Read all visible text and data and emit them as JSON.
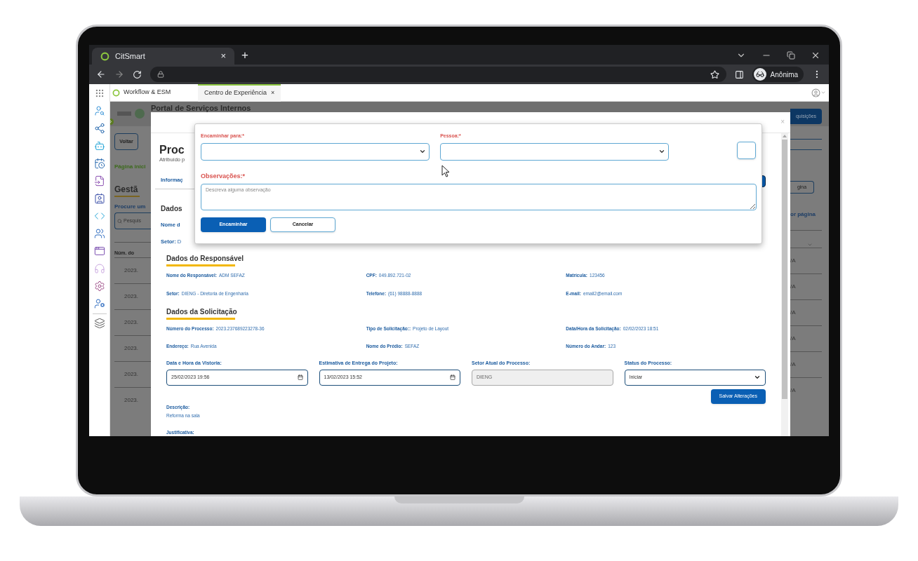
{
  "browser": {
    "tab": {
      "title": "CitSmart",
      "close": "×"
    },
    "new_tab": "+",
    "profile": "Anônima"
  },
  "app": {
    "product": "Workflow & ESM",
    "tab": {
      "title": "Centro de Experiência",
      "close": "×"
    }
  },
  "background_page": {
    "header": "Portal de Serviços Internos",
    "top_button": "quisições",
    "back_button": "Voltar",
    "breadcrumb": "Página inici",
    "heading": "Gestã",
    "search_label": "Procure um",
    "search_placeholder": "Pesquis",
    "column_1": "Núm. do",
    "right_button": "gina",
    "per_page": "or página",
    "rows": [
      {
        "column_1": "2023.",
        "column_2": "/A"
      },
      {
        "column_1": "2023.",
        "column_2": "/A"
      },
      {
        "column_1": "2023.",
        "column_2": "/A"
      },
      {
        "column_1": "2023.",
        "column_2": "/A"
      },
      {
        "column_1": "2023.",
        "column_2": "/A"
      },
      {
        "column_1": "2023.",
        "column_2": "/A"
      }
    ]
  },
  "process_modal": {
    "close": "×",
    "title": "Proc",
    "subtitle": "Atribuído p",
    "tab": "Informaç",
    "section_heading": "Dados",
    "field_1": "Nome d",
    "field_2": {
      "label": "Setor:",
      "value": "D"
    },
    "sections": [
      {
        "title": "Dados do Responsável",
        "fields": [
          {
            "label": "Nome do Responsável:",
            "value": "ADM SEFAZ"
          },
          {
            "label": "CPF:",
            "value": "049.892.721-02"
          },
          {
            "label": "Matrícula:",
            "value": "123456"
          },
          {
            "label": "Setor:",
            "value": "DIENG - Diretoria de Engenharia"
          },
          {
            "label": "Telefone:",
            "value": "(61) 98888-8888"
          },
          {
            "label": "E-mail:",
            "value": "email2@email.com"
          }
        ]
      },
      {
        "title": "Dados da Solicitação",
        "fields": [
          {
            "label": "Número do Processo:",
            "value": "2023.237689223278-36"
          },
          {
            "label": "Tipo de Solicitação::",
            "value": "Projeto de Layout"
          },
          {
            "label": "Data/Hora da Solicitação:",
            "value": "02/02/2023 18:51"
          },
          {
            "label": "Endereço:",
            "value": "Rua Avenida"
          },
          {
            "label": "Nome do Prédio:",
            "value": "SEFAZ"
          },
          {
            "label": "Número do Andar:",
            "value": "123"
          }
        ]
      }
    ],
    "inputs": [
      {
        "label": "Data e Hora da Vistoria:",
        "value": "25/02/2023 19:56",
        "kind": "datetime",
        "disabled": false
      },
      {
        "label": "Estimativa de Entrega do Projeto:",
        "value": "13/02/2023 15:52",
        "kind": "datetime",
        "disabled": false
      },
      {
        "label": "Setor Atual do Processo:",
        "value": "DIENG",
        "kind": "text",
        "disabled": true
      },
      {
        "label": "Status do Processo:",
        "value": "Iniciar",
        "kind": "select",
        "disabled": false
      }
    ],
    "save_button": "Salvar Alterações",
    "description": {
      "label": "Descrição:",
      "value": "Reforma na sala"
    },
    "justification_label": "Justificativa:"
  },
  "forward_modal": {
    "forward_to": {
      "label": "Encaminhar para:*"
    },
    "person": {
      "label": "Pessoa:*"
    },
    "notes": {
      "label": "Observações:*",
      "placeholder": "Descreva alguma observação"
    },
    "buttons": [
      {
        "label": "Encaminhar",
        "kind": "primary"
      },
      {
        "label": "Cancelar",
        "kind": "secondary"
      }
    ]
  }
}
